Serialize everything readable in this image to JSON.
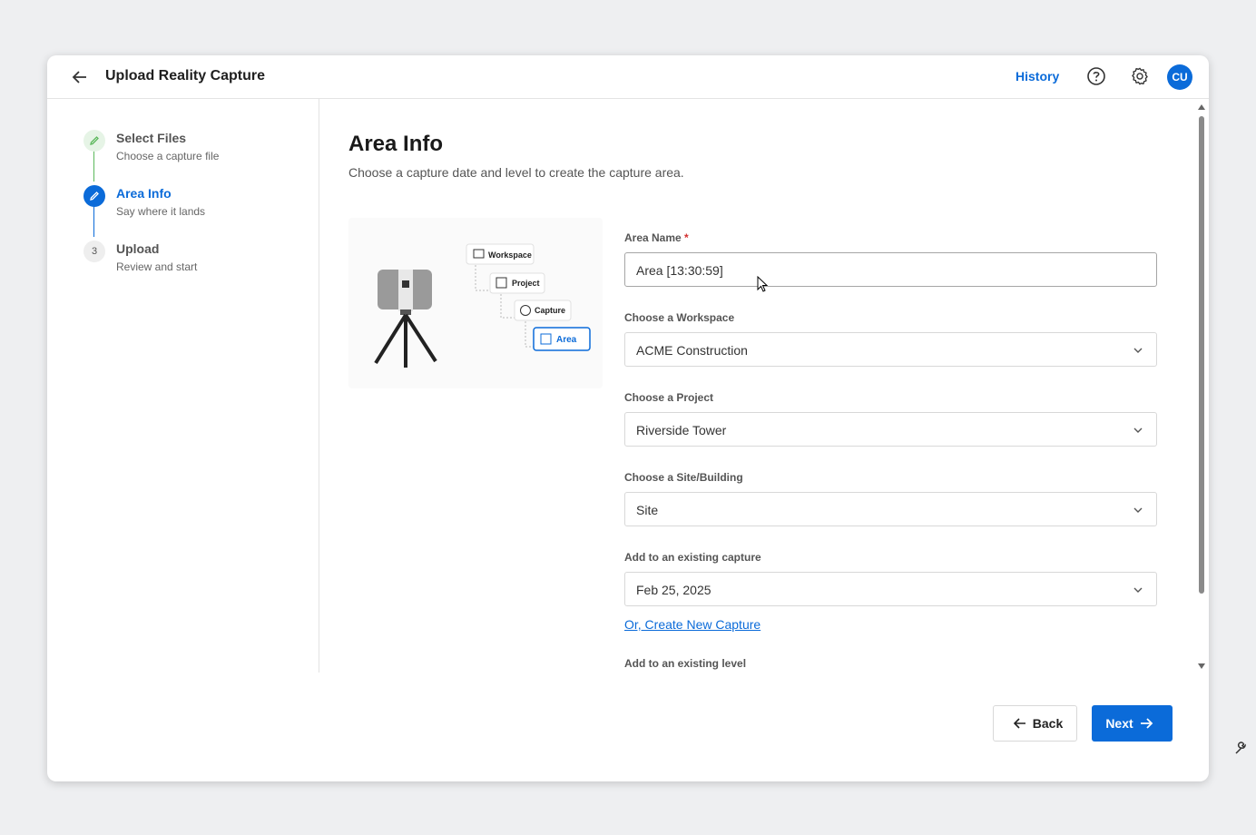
{
  "header": {
    "title": "Upload Reality Capture",
    "history_label": "History",
    "avatar_initials": "CU"
  },
  "steps": [
    {
      "number": "",
      "title": "Select Files",
      "subtitle": "Choose a capture file",
      "state": "done"
    },
    {
      "number": "",
      "title": "Area Info",
      "subtitle": "Say where it lands",
      "state": "active"
    },
    {
      "number": "3",
      "title": "Upload",
      "subtitle": "Review and start",
      "state": "pending"
    }
  ],
  "main": {
    "heading": "Area Info",
    "description": "Choose a capture date and level to create the capture area.",
    "illustration": {
      "tree": [
        "Workspace",
        "Project",
        "Capture",
        "Area"
      ]
    },
    "form": {
      "area_name_label": "Area Name",
      "area_name_required": "*",
      "area_name_value": "Area [13:30:59]",
      "workspace_label": "Choose a Workspace",
      "workspace_value": "ACME Construction",
      "project_label": "Choose a Project",
      "project_value": "Riverside Tower",
      "site_label": "Choose a Site/Building",
      "site_value": "Site",
      "capture_label": "Add to an existing capture",
      "capture_value": "Feb 25, 2025",
      "create_capture_link": "Or, Create New Capture",
      "level_label": "Add to an existing level"
    }
  },
  "footer": {
    "back_label": "Back",
    "next_label": "Next"
  },
  "colors": {
    "accent": "#0b6bd9",
    "done": "#5cb85c",
    "background": "#eeeff1"
  }
}
